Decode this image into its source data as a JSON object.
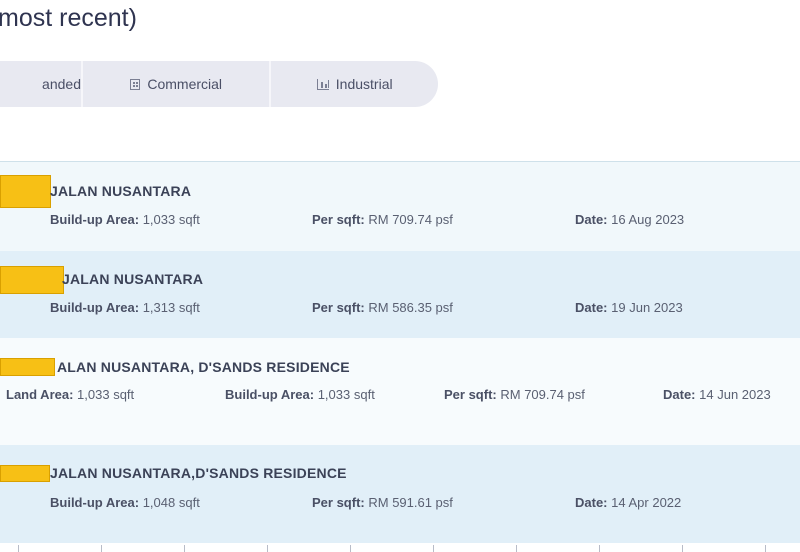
{
  "heading": "most recent)",
  "filters": [
    {
      "label": "anded",
      "icon": "house-icon"
    },
    {
      "label": "Commercial",
      "icon": "building-icon"
    },
    {
      "label": "Industrial",
      "icon": "factory-icon"
    }
  ],
  "transactions": [
    {
      "address": "JALAN NUSANTARA",
      "build_up_label": "Build-up Area:",
      "build_up": "1,033 sqft",
      "per_sqft_label": "Per sqft:",
      "per_sqft": "RM 709.74 psf",
      "date_label": "Date:",
      "date": "16 Aug 2023"
    },
    {
      "address": "JALAN NUSANTARA",
      "build_up_label": "Build-up Area:",
      "build_up": "1,313 sqft",
      "per_sqft_label": "Per sqft:",
      "per_sqft": "RM 586.35 psf",
      "date_label": "Date:",
      "date": "19 Jun 2023"
    },
    {
      "address": "ALAN NUSANTARA, D'SANDS RESIDENCE",
      "land_label": "Land Area:",
      "land": "1,033 sqft",
      "build_up_label": "Build-up Area:",
      "build_up": "1,033 sqft",
      "per_sqft_label": "Per sqft:",
      "per_sqft": "RM 709.74 psf",
      "date_label": "Date:",
      "date": "14 Jun 2023"
    },
    {
      "address": "JALAN NUSANTARA,D'SANDS RESIDENCE",
      "build_up_label": "Build-up Area:",
      "build_up": "1,048 sqft",
      "per_sqft_label": "Per sqft:",
      "per_sqft": "RM 591.61 psf",
      "date_label": "Date:",
      "date": "14 Apr 2022"
    }
  ],
  "colors": {
    "redaction": "#f7c015",
    "row_light": "#f1f8fb",
    "row_blue": "#e1eff8",
    "filter_bg": "#e8e9f1"
  }
}
